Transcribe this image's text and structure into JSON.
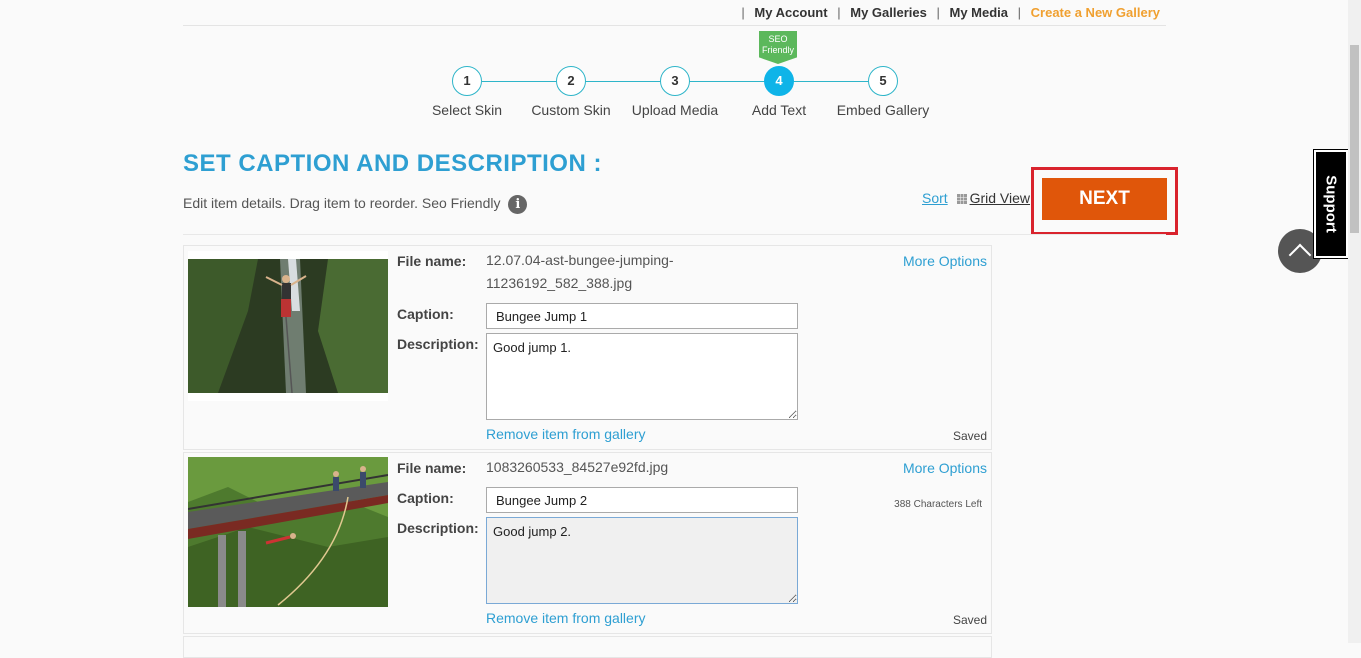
{
  "topnav": {
    "my_account": "My Account",
    "my_galleries": "My Galleries",
    "my_media": "My Media",
    "create_gallery": "Create a New Gallery",
    "separator": "|"
  },
  "steps": [
    {
      "num": "1",
      "label": "Select Skin"
    },
    {
      "num": "2",
      "label": "Custom Skin"
    },
    {
      "num": "3",
      "label": "Upload Media"
    },
    {
      "num": "4",
      "label": "Add Text"
    },
    {
      "num": "5",
      "label": "Embed Gallery"
    }
  ],
  "seo_flag": "SEO Friendly",
  "heading": "SET CAPTION AND DESCRIPTION :",
  "subtext": "Edit item details. Drag item to reorder. Seo Friendly",
  "info_icon_glyph": "i",
  "sort_label": "Sort",
  "grid_view_label": "Grid View",
  "next_label": "NEXT",
  "support_label": "Support",
  "labels": {
    "file_name": "File name:",
    "caption": "Caption:",
    "description": "Description:",
    "more_options": "More Options",
    "remove": "Remove item from gallery",
    "saved": "Saved"
  },
  "items": [
    {
      "file_name": "12.07.04-ast-bungee-jumping-11236192_582_388.jpg",
      "caption": "Bungee Jump 1",
      "description": "Good jump 1."
    },
    {
      "file_name": "1083260533_84527e92fd.jpg",
      "caption": "Bungee Jump 2",
      "description": "Good jump 2.",
      "chars_left": "388 Characters Left"
    }
  ],
  "colors": {
    "accent_blue": "#2e9fd2",
    "next_orange": "#e0560a",
    "highlight_red": "#d9232d",
    "step_active": "#0fb4e8",
    "seo_green": "#5cb85c"
  }
}
